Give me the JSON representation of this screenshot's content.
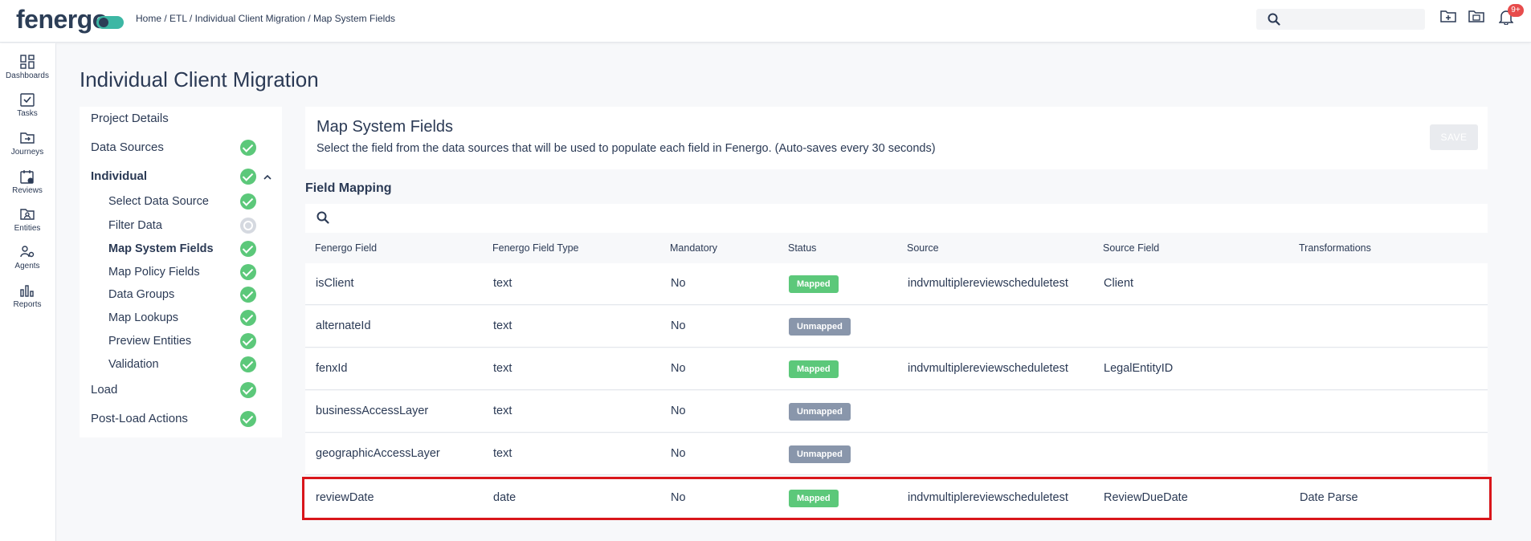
{
  "header": {
    "logo_text": "fenergo",
    "breadcrumb": "Home / ETL / Individual Client Migration / Map System Fields",
    "search_placeholder": "",
    "notification_count": "9+"
  },
  "nav": [
    {
      "label": "Dashboards",
      "icon": "dashboard-icon"
    },
    {
      "label": "Tasks",
      "icon": "tasks-icon"
    },
    {
      "label": "Journeys",
      "icon": "journeys-icon"
    },
    {
      "label": "Reviews",
      "icon": "reviews-icon"
    },
    {
      "label": "Entities",
      "icon": "entities-icon"
    },
    {
      "label": "Agents",
      "icon": "agents-icon"
    },
    {
      "label": "Reports",
      "icon": "reports-icon"
    }
  ],
  "page_title": "Individual Client Migration",
  "steps": [
    {
      "label": "Project Details",
      "status": "none"
    },
    {
      "label": "Data Sources",
      "status": "complete"
    },
    {
      "label": "Individual",
      "status": "complete"
    },
    {
      "label": "Select Data Source",
      "status": "complete"
    },
    {
      "label": "Filter Data",
      "status": "pending"
    },
    {
      "label": "Map System Fields",
      "status": "complete"
    },
    {
      "label": "Map Policy Fields",
      "status": "complete"
    },
    {
      "label": "Data Groups",
      "status": "complete"
    },
    {
      "label": "Map Lookups",
      "status": "complete"
    },
    {
      "label": "Preview Entities",
      "status": "complete"
    },
    {
      "label": "Validation",
      "status": "complete"
    },
    {
      "label": "Load",
      "status": "complete"
    },
    {
      "label": "Post-Load Actions",
      "status": "complete"
    }
  ],
  "main": {
    "title": "Map System Fields",
    "description": "Select the field from the data sources that will be used to populate each field in Fenergo. (Auto-saves every 30 seconds)",
    "save_label": "SAVE",
    "section_title": "Field Mapping"
  },
  "table": {
    "columns": [
      "Fenergo Field",
      "Fenergo Field Type",
      "Mandatory",
      "Status",
      "Source",
      "Source Field",
      "Transformations"
    ],
    "rows": [
      [
        "isClient",
        "text",
        "No",
        "Mapped",
        "indvmultiplereviewscheduletest",
        "Client",
        ""
      ],
      [
        "alternateId",
        "text",
        "No",
        "Unmapped",
        "",
        "",
        ""
      ],
      [
        "fenxId",
        "text",
        "No",
        "Mapped",
        "indvmultiplereviewscheduletest",
        "LegalEntityID",
        ""
      ],
      [
        "businessAccessLayer",
        "text",
        "No",
        "Unmapped",
        "",
        "",
        ""
      ],
      [
        "geographicAccessLayer",
        "text",
        "No",
        "Unmapped",
        "",
        "",
        ""
      ],
      [
        "reviewDate",
        "date",
        "No",
        "Mapped",
        "indvmultiplereviewscheduletest",
        "ReviewDueDate",
        "Date Parse"
      ]
    ]
  },
  "colors": {
    "mapped": "#5cc87a",
    "unmapped": "#8996ab",
    "highlight": "#d9161b",
    "brand_accent": "#3db7a4"
  }
}
